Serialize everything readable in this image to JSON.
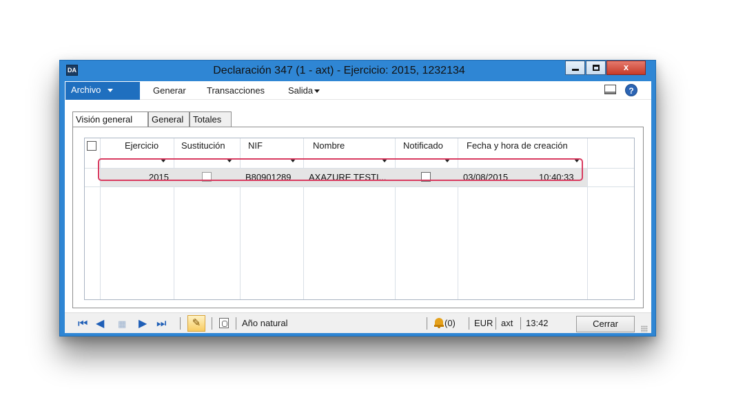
{
  "window": {
    "title": "Declaración 347 (1 - axt) - Ejercicio: 2015, 1232134",
    "app_icon_text": "DA",
    "close_glyph": "x"
  },
  "ribbon": {
    "archivo_label": "Archivo",
    "items": [
      "Generar",
      "Transacciones",
      "Salida"
    ],
    "help_glyph": "?"
  },
  "tabs": [
    "Visión general",
    "General",
    "Totales"
  ],
  "grid": {
    "columns": [
      "Ejercicio",
      "Sustitución",
      "NIF",
      "Nombre",
      "Notificado",
      "Fecha y hora de creación"
    ],
    "rows": [
      {
        "ejercicio": "2015",
        "sustitucion": false,
        "nif": "B80901289",
        "nombre": "AXAZURE TESTI...",
        "notificado": false,
        "fecha": "03/08/2015",
        "hora": "10:40:33"
      }
    ]
  },
  "status": {
    "period": "Año natural",
    "alerts": "(0)",
    "currency": "EUR",
    "company": "axt",
    "time": "13:42",
    "close_label": "Cerrar"
  },
  "colors": {
    "titlebar": "#2f86d4",
    "archivo_button": "#1f6fbf",
    "highlight": "#d83a5f"
  },
  "icons": [
    "app-icon",
    "minimize-icon",
    "maximize-icon",
    "close-icon",
    "layout-icon",
    "help-icon",
    "first-record-icon",
    "previous-record-icon",
    "grid-view-icon",
    "next-record-icon",
    "last-record-icon",
    "edit-pencil-icon",
    "attachment-icon",
    "bell-icon"
  ]
}
